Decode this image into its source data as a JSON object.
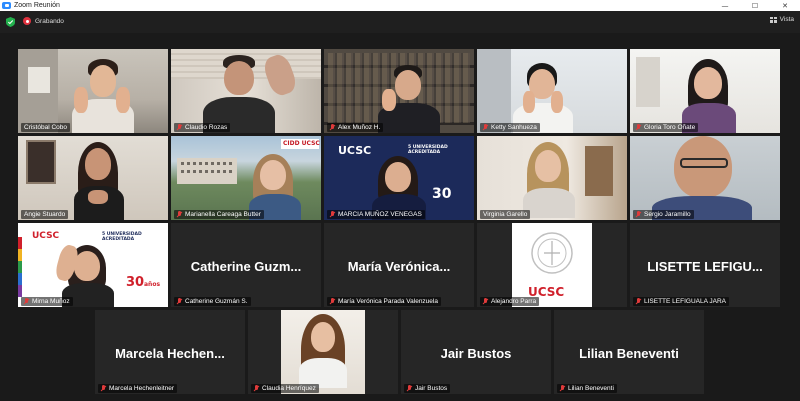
{
  "window": {
    "title": "Zoom Reunión",
    "controls": [
      "—",
      "☐",
      "✕"
    ]
  },
  "topbar": {
    "recording_label": "Grabando",
    "view_label": "Vista"
  },
  "participants": [
    {
      "name": "Cristóbal Cobo",
      "muted": false
    },
    {
      "name": "Claudio Rozas",
      "muted": true
    },
    {
      "name": "Alex Muñoz H.",
      "muted": true
    },
    {
      "name": "Ketty Sanhueza",
      "muted": true
    },
    {
      "name": "Gloria Toro Oñate",
      "muted": true
    },
    {
      "name": "Angie Stuardo",
      "muted": false
    },
    {
      "name": "Marianella Careaga Butter",
      "muted": true
    },
    {
      "name": "MARCIA MUÑOZ VENEGAS",
      "muted": true
    },
    {
      "name": "Virginia Garello",
      "muted": false,
      "active_speaker": true
    },
    {
      "name": "Sergio Jaramillo",
      "muted": true
    },
    {
      "name": "Mirna Muñoz",
      "muted": true
    },
    {
      "name": "Catherine Guzmán S.",
      "muted": true,
      "display": "Catherine Guzm..."
    },
    {
      "name": "María Verónica Parada Valenzuela",
      "muted": true,
      "display": "María Verónica..."
    },
    {
      "name": "Alejandro Parra",
      "muted": true
    },
    {
      "name": "LISETTE LEFIGUALA JARA",
      "muted": true,
      "display": "LISETTE LEFIGU..."
    },
    {
      "name": "Marcela Hechenleitner",
      "muted": true,
      "display": "Marcela Hechen..."
    },
    {
      "name": "Claudia Henríquez",
      "muted": true
    },
    {
      "name": "Jair Bustos",
      "muted": true,
      "display": "Jair Bustos"
    },
    {
      "name": "Lilian Beneventi",
      "muted": true,
      "display": "Lilian Beneventi"
    }
  ],
  "backgrounds": {
    "ucsc": "UCSC",
    "ucsc_red": "UCSC",
    "anniversary": "30",
    "anniversary_sub": "años",
    "cidd": "CIDD UCSC",
    "accredited": "5 UNIVERSIDAD ACREDITADA"
  },
  "colors": {
    "active_border": "#c7e32a",
    "recording": "#e0323f",
    "muted": "#e03b3b",
    "tile_bg": "#262626",
    "ucsc_red": "#d0202b",
    "ucsc_blue": "#1c2a5a"
  }
}
